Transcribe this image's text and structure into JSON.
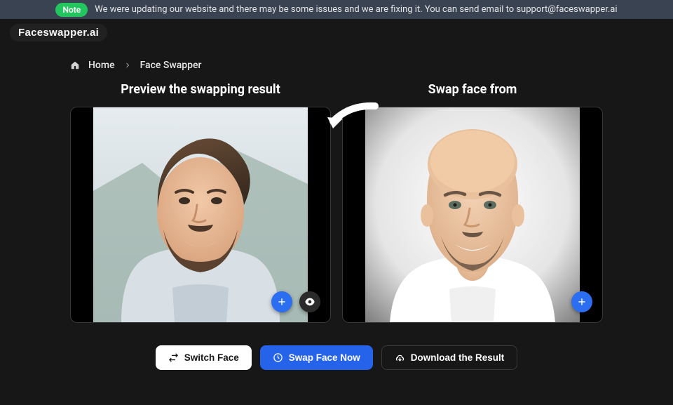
{
  "note": {
    "badge": "Note",
    "text": "We were updating our website and there may be some issues and we are fixing it. You can send email to support@faceswapper.ai"
  },
  "logo": "Faceswapper.ai",
  "breadcrumb": {
    "home": "Home",
    "current": "Face Swapper"
  },
  "panels": {
    "left": {
      "title": "Preview the swapping result"
    },
    "right": {
      "title": "Swap face from"
    }
  },
  "buttons": {
    "switch": "Switch Face",
    "swap": "Swap Face Now",
    "download": "Download the Result"
  }
}
